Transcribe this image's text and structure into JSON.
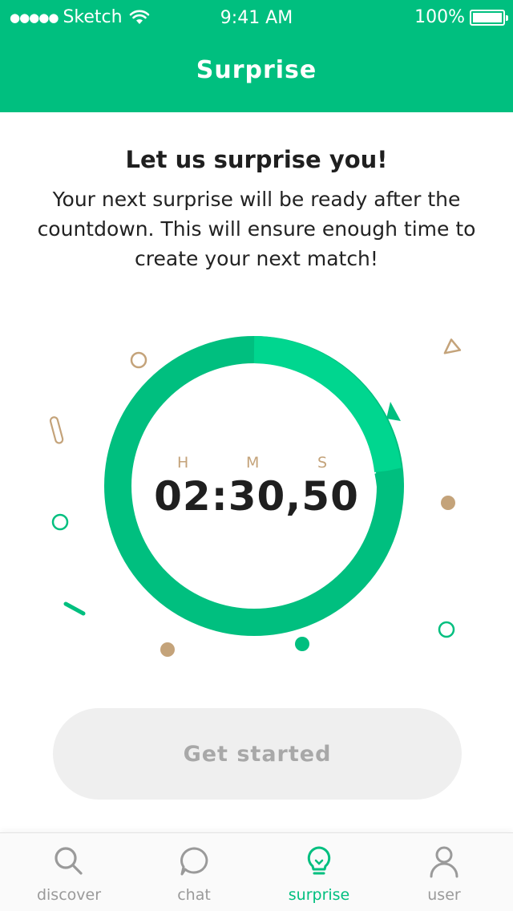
{
  "status_bar": {
    "carrier": "Sketch",
    "signal_dots": "●●●●●",
    "time": "9:41 AM",
    "battery": "100%"
  },
  "nav": {
    "title": "Surprise"
  },
  "intro": {
    "title": "Let us surprise you!",
    "text": "Your next surprise will be ready after the countdown. This will ensure enough time to create your next match!"
  },
  "timer": {
    "unit_h": "H",
    "unit_m": "M",
    "unit_s": "S",
    "value": "02:30,50"
  },
  "cta": {
    "label": "Get started"
  },
  "tabs": [
    {
      "label": "discover",
      "icon": "search-icon",
      "active": false
    },
    {
      "label": "chat",
      "icon": "chat-bubble-icon",
      "active": false
    },
    {
      "label": "surprise",
      "icon": "lightbulb-icon",
      "active": true
    },
    {
      "label": "user",
      "icon": "user-icon",
      "active": false
    }
  ],
  "colors": {
    "brand": "#00BF7F",
    "ring_light": "#00D68F",
    "accent_tan": "#C4A37A",
    "button_bg": "#EFEFEF",
    "button_text": "#A8A8A8"
  }
}
